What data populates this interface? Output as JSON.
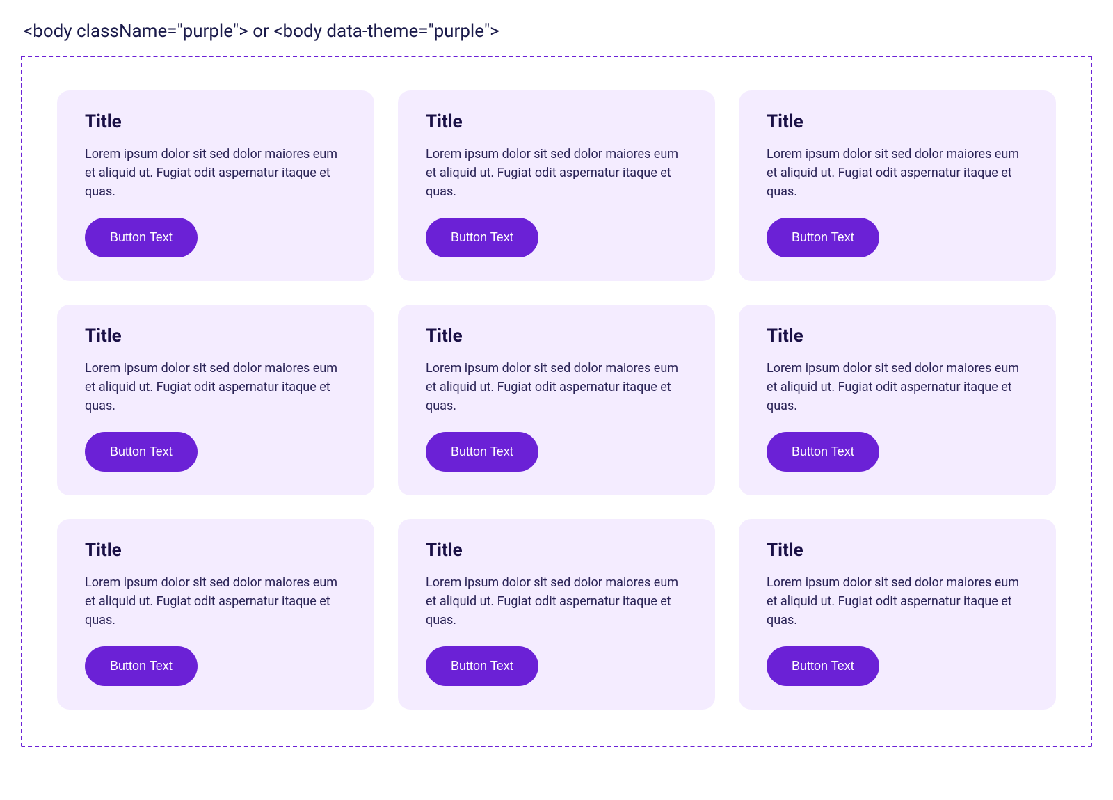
{
  "header": {
    "label": "<body className=\"purple\"> or <body data-theme=\"purple\">"
  },
  "colors": {
    "accent": "#6b21d6",
    "card_bg": "#f4ecff",
    "text_dark": "#1a1046"
  },
  "cards": [
    {
      "title": "Title",
      "body": "Lorem ipsum dolor sit sed dolor maiores eum et aliquid ut. Fugiat odit aspernatur itaque et quas.",
      "button": "Button Text"
    },
    {
      "title": "Title",
      "body": "Lorem ipsum dolor sit sed dolor maiores eum et aliquid ut. Fugiat odit aspernatur itaque et quas.",
      "button": "Button Text"
    },
    {
      "title": "Title",
      "body": "Lorem ipsum dolor sit sed dolor maiores eum et aliquid ut. Fugiat odit aspernatur itaque et quas.",
      "button": "Button Text"
    },
    {
      "title": "Title",
      "body": "Lorem ipsum dolor sit sed dolor maiores eum et aliquid ut. Fugiat odit aspernatur itaque et quas.",
      "button": "Button Text"
    },
    {
      "title": "Title",
      "body": "Lorem ipsum dolor sit sed dolor maiores eum et aliquid ut. Fugiat odit aspernatur itaque et quas.",
      "button": "Button Text"
    },
    {
      "title": "Title",
      "body": "Lorem ipsum dolor sit sed dolor maiores eum et aliquid ut. Fugiat odit aspernatur itaque et quas.",
      "button": "Button Text"
    },
    {
      "title": "Title",
      "body": "Lorem ipsum dolor sit sed dolor maiores eum et aliquid ut. Fugiat odit aspernatur itaque et quas.",
      "button": "Button Text"
    },
    {
      "title": "Title",
      "body": "Lorem ipsum dolor sit sed dolor maiores eum et aliquid ut. Fugiat odit aspernatur itaque et quas.",
      "button": "Button Text"
    },
    {
      "title": "Title",
      "body": "Lorem ipsum dolor sit sed dolor maiores eum et aliquid ut. Fugiat odit aspernatur itaque et quas.",
      "button": "Button Text"
    }
  ]
}
